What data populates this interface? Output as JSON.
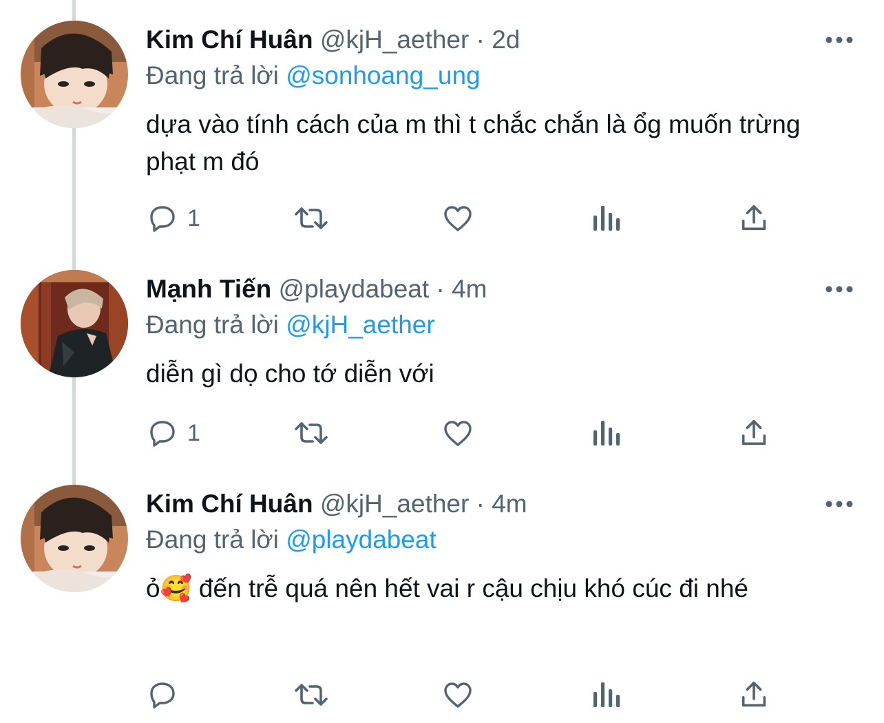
{
  "tweets": [
    {
      "name": "Kim Chí Huân",
      "handle": "@kjH_aether",
      "separator": "·",
      "time": "2d",
      "replying_prefix": "Đang trả lời",
      "replying_to": "@sonhoang_ung",
      "text": "dựa vào tính cách của m thì t chắc chắn là ổg muốn trừng phạt m đó",
      "reply_count": "1",
      "avatar": "portrait-person-resting-head"
    },
    {
      "name": "Mạnh Tiến",
      "handle": "@playdabeat",
      "separator": "·",
      "time": "4m",
      "replying_prefix": "Đang trả lời",
      "replying_to": "@kjH_aether",
      "text": "diễn gì dọ cho tớ diễn với",
      "reply_count": "1",
      "avatar": "portrait-person-dark-jacket"
    },
    {
      "name": "Kim Chí Huân",
      "handle": "@kjH_aether",
      "separator": "·",
      "time": "4m",
      "replying_prefix": "Đang trả lời",
      "replying_to": "@playdabeat",
      "text": "ỏ🥰 đến trễ quá nên hết vai r cậu chịu khó cúc đi nhé",
      "reply_count": "",
      "avatar": "portrait-person-resting-head"
    }
  ],
  "icons": {
    "reply": "reply-bubble-icon",
    "retweet": "retweet-arrows-icon",
    "like": "heart-icon",
    "views": "bar-chart-icon",
    "share": "share-upload-icon",
    "more": "more-dots-icon"
  },
  "colors": {
    "text": "#0f1419",
    "secondary": "#536471",
    "link": "#1d9bf0",
    "thread_line": "#cfd9de"
  }
}
